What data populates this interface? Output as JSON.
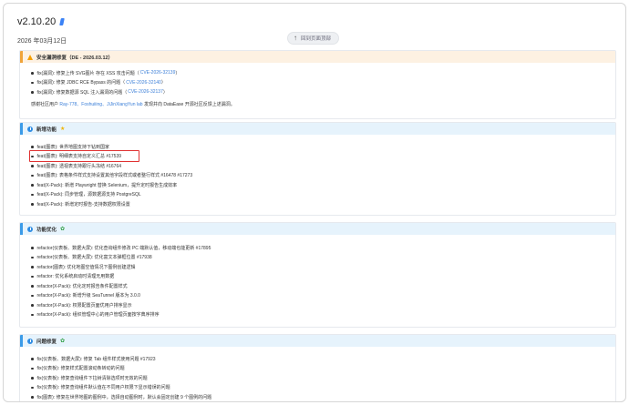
{
  "header": {
    "version": "v2.10.20",
    "date": "2026 年03月12日",
    "back_to_top": "回到页面顶部"
  },
  "sections": {
    "security": {
      "title": "安全漏洞修复（DE - 2026.03.12）",
      "items": [
        {
          "text": "fix(漏洞): 修复上传 SVG图片 存在 XSS 攻击问题（",
          "link": "CVE-2026-32139",
          "tail": "）"
        },
        {
          "text": "fix(漏洞): 修复 JDBC RCE Bypass 的问题（",
          "link": "CVE-2026-32140",
          "tail": "）"
        },
        {
          "text": "fix(漏洞): 修复数据源 SQL 注入漏洞的问题（",
          "link": "CVE-2026-32137",
          "tail": "）"
        }
      ],
      "note_prefix": "感谢社区用户 ",
      "note_links": "Ray-778、Foshuiiing、JiJinXiangYun lab",
      "note_suffix": " 发现并向 DataEase 开源社区反馈上述漏洞。"
    },
    "features": {
      "title": "新增功能",
      "title_emoji": "★",
      "items": [
        "feat(图表): 世界地图支持下钻到国家",
        "feat(图表): 明细表支持自定义汇总 #17539",
        "feat(图表): 透视表支持跟行头冻结 #16764",
        "feat(图表): 表格条件样式支持设置其他字段样式或者整行样式 #16478 #17273",
        "feat(X-Pack): 新增 Playwright 替换 Selenium，提升定时报告生成效率",
        "feat(X-Pack): 同步管理，源数据源支持 PostgreSQL",
        "feat(X-Pack): 新增定时报告-支持数据权限设置"
      ]
    },
    "optimizations": {
      "title": "功能优化",
      "title_emoji": "✿",
      "items": [
        "refactor(仪表板、数据大屏): 优化查询组件修改 PC 端默认值，移动端也能更新 #17895",
        "refactor(仪表板、数据大屏): 优化富文本弹框位置 #17938",
        "refactor(图表): 优化地图空值情况下图例创建逻辑",
        "refactor: 优化系统启动时清理无用数据",
        "refactor(X-Pack): 优化定时报告条件配置样式",
        "refactor(X-Pack): 新增升级 SeaTunnel 版本为 3.0.0",
        "refactor(X-Pack): 权限配置页面优用户排序显示",
        "refactor(X-Pack): 组织管理中心的用户管理页面按字典序排序"
      ]
    },
    "bugfixes": {
      "title": "问题修复",
      "title_emoji": "✿",
      "items": [
        "fix(仪表板、数据大屏): 修复 Tab 组件样式使用问题 #17923",
        "fix(仪表板): 修复样式配置滚动条转动的问题",
        "fix(仪表板): 修复查询组件下拉树清除选项时无效的问题",
        "fix(仪表板): 修复查询组件默认值在不同用户权限下显示错误的问题",
        "fix(图表): 修复在世界地图的图例中，选择自动图例时，默认会固定创建 9 个图例的问题"
      ]
    }
  }
}
